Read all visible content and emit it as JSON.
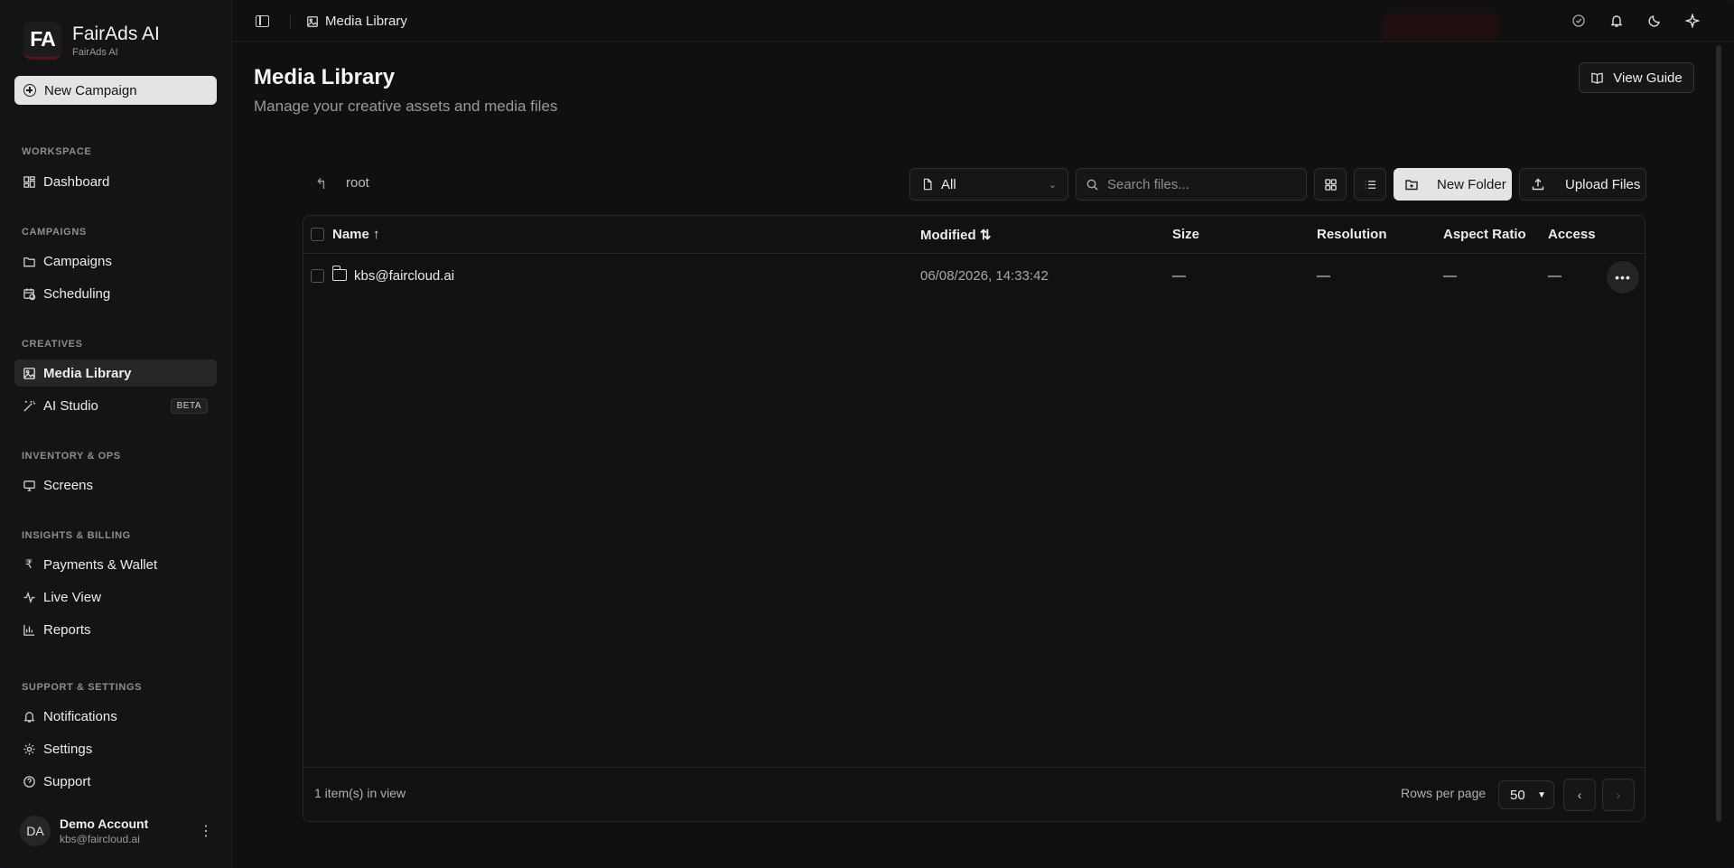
{
  "brand": {
    "logo_text": "FA",
    "name": "FairAds AI",
    "subtitle": "FairAds AI"
  },
  "sidebar": {
    "new_campaign_label": "New Campaign",
    "sections": {
      "workspace": "WORKSPACE",
      "campaigns": "CAMPAIGNS",
      "creatives": "CREATIVES",
      "inventory": "INVENTORY & OPS",
      "insights": "INSIGHTS & BILLING",
      "support": "SUPPORT & SETTINGS"
    },
    "items": {
      "dashboard": "Dashboard",
      "campaigns": "Campaigns",
      "scheduling": "Scheduling",
      "media_library": "Media Library",
      "ai_studio": "AI Studio",
      "ai_studio_badge": "BETA",
      "screens": "Screens",
      "payments": "Payments & Wallet",
      "live_view": "Live View",
      "reports": "Reports",
      "notifications": "Notifications",
      "settings": "Settings",
      "support": "Support"
    },
    "account": {
      "initials": "DA",
      "name": "Demo Account",
      "email": "kbs@faircloud.ai"
    }
  },
  "topbar": {
    "breadcrumb": "Media Library"
  },
  "page": {
    "title": "Media Library",
    "subtitle": "Manage your creative assets and media files",
    "view_guide_label": "View Guide"
  },
  "toolbar": {
    "path_root": "root",
    "filter_value": "All",
    "search_placeholder": "Search files...",
    "new_folder_label": "New Folder",
    "upload_label": "Upload Files"
  },
  "table": {
    "columns": {
      "name": "Name",
      "modified": "Modified",
      "size": "Size",
      "resolution": "Resolution",
      "aspect_ratio": "Aspect Ratio",
      "access": "Access"
    },
    "rows": [
      {
        "name": "kbs@faircloud.ai",
        "modified": "06/08/2026, 14:33:42",
        "size": "—",
        "resolution": "—",
        "aspect_ratio": "—",
        "access": "—"
      }
    ],
    "footer": {
      "item_count": "1 item(s) in view",
      "rows_per_page_label": "Rows per page",
      "rows_per_page_value": "50"
    }
  },
  "icons": {
    "sort_asc": "↑",
    "sort_both": "⇅",
    "back": "↰",
    "more": "•••",
    "prev": "‹",
    "next": "›",
    "kebab": "⋮",
    "rupee": "₹"
  }
}
